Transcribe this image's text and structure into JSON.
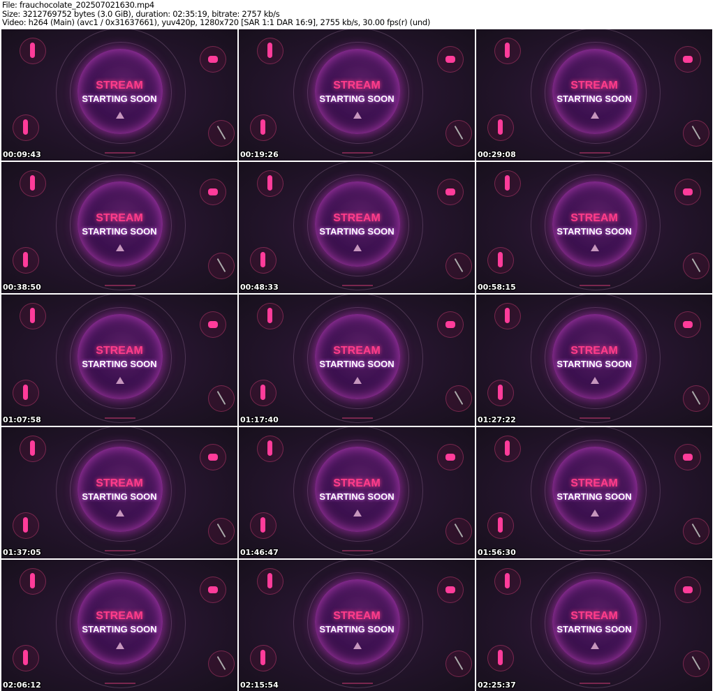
{
  "header": {
    "file": "File: frauchocolate_202507021630.mp4",
    "size": "Size: 3212769752 bytes (3.0 GiB), duration: 02:35:19, bitrate: 2757 kb/s",
    "video": "Video: h264 (Main) (avc1 / 0x31637661), yuv420p, 1280x720 [SAR 1:1 DAR 16:9], 2755 kb/s, 30.00 fps(r) (und)"
  },
  "thumb_text": {
    "line1": "STREAM",
    "line2": "STARTING SOON"
  },
  "timestamps": [
    "00:09:43",
    "00:19:26",
    "00:29:08",
    "00:38:50",
    "00:48:33",
    "00:58:15",
    "01:07:58",
    "01:17:40",
    "01:27:22",
    "01:37:05",
    "01:46:47",
    "01:56:30",
    "02:06:12",
    "02:15:54",
    "02:25:37"
  ]
}
